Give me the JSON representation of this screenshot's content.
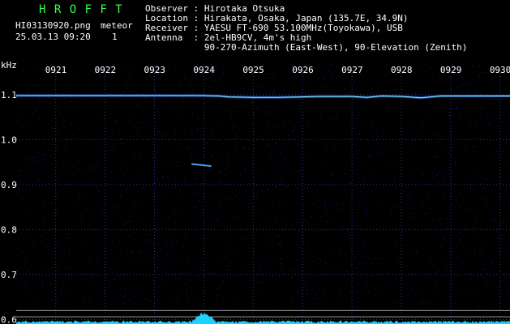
{
  "app": {
    "title": "H R O F F T"
  },
  "file": {
    "name": "HI03130920.png",
    "datetime": "25.03.13 09:20"
  },
  "meteor": {
    "label": "meteor",
    "count": "1"
  },
  "header": {
    "observer": "Observer : Hirotaka Otsuka",
    "location": "Location : Hirakata, Osaka, Japan (135.7E, 34.9N)",
    "receiver": "Receiver : YAESU FT-690 53.100MHz(Toyokawa), USB",
    "antenna": "Antenna  : 2el-HB9CV, 4m's high",
    "antenna_detail": "           90-270-Azimuth (East-West), 90-Elevation (Zenith)"
  },
  "colors": {
    "background": "#000000",
    "title_green": "#39ff4a",
    "carrier_line": "#2f7fff",
    "carrier_glow": "#7ff0ff",
    "noise": "#1c2a9a",
    "meteor_echo": "#4aa0ff",
    "spectrum": "#20d0ff",
    "gridline": "#9a9a9a"
  },
  "chart_data": {
    "type": "heatmap",
    "ylabel": "kHz",
    "y_ticks": [
      "1.1",
      "1.0",
      "0.9",
      "0.8",
      "0.7",
      "0.6"
    ],
    "y_tick_values": [
      1.1,
      1.0,
      0.9,
      0.8,
      0.7,
      0.6
    ],
    "ylim": [
      0.59,
      1.17
    ],
    "x_ticks": [
      "0921",
      "0922",
      "0923",
      "0924",
      "0925",
      "0926",
      "0927",
      "0928",
      "0929",
      "0930"
    ],
    "x_tick_values": [
      921,
      922,
      923,
      924,
      925,
      926,
      927,
      928,
      929,
      930
    ],
    "xlim": [
      920.2,
      930.2
    ],
    "carrier": {
      "x": [
        920.2,
        923.0,
        924.0,
        924.3,
        924.5,
        925.0,
        925.5,
        926.0,
        926.3,
        927.0,
        927.3,
        927.6,
        928.0,
        928.4,
        928.8,
        929.5,
        930.2
      ],
      "khz": [
        1.098,
        1.098,
        1.098,
        1.097,
        1.095,
        1.094,
        1.094,
        1.095,
        1.096,
        1.096,
        1.094,
        1.097,
        1.096,
        1.093,
        1.097,
        1.097,
        1.097
      ]
    },
    "meteor_echo": {
      "x": [
        923.75,
        924.15
      ],
      "khz": [
        0.946,
        0.941
      ]
    },
    "reference_lines_khz": [
      0.62,
      0.606
    ],
    "spectrum_peak_x": 924.0
  }
}
